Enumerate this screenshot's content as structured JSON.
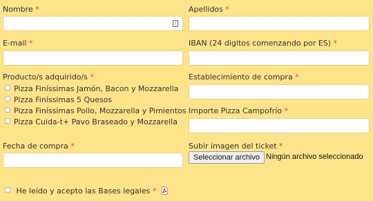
{
  "colors": {
    "background": "#fde38a",
    "required": "#e8452c"
  },
  "fields": {
    "nombre": {
      "label": "Nombre",
      "required_mark": "*",
      "value": ""
    },
    "apellidos": {
      "label": "Apellidos",
      "required_mark": "*",
      "value": ""
    },
    "email": {
      "label": "E-mail",
      "required_mark": "*",
      "value": ""
    },
    "iban": {
      "label": "IBAN (24 digitos comenzando por ES)",
      "required_mark": "*",
      "value": ""
    },
    "producto": {
      "label": "Producto/s adquirido/s",
      "required_mark": "*",
      "options": [
        "Pizza Finíssimas Jamón, Bacon y Mozzarella",
        "Pizza Finíssimas 5 Quesos",
        "Pizza Finíssimas Pollo, Mozzarella y Pimientos",
        "Pizza Cuida-t+ Pavo Braseado y Mozzarella"
      ]
    },
    "establecimiento": {
      "label": "Establecimiento de compra",
      "required_mark": "*",
      "value": ""
    },
    "importe": {
      "label": "Importe Pizza Campofrío",
      "required_mark": "*",
      "value": ""
    },
    "fecha": {
      "label": "Fecha de compra",
      "required_mark": "*",
      "value": ""
    },
    "ticket": {
      "label": "Subir imagen del ticket",
      "required_mark": "*",
      "button_label": "Seleccionar archivo",
      "status": "Ningún archivo seleccionado"
    }
  },
  "legal": {
    "label": "He leído y acepto las Bases legales",
    "required_mark": "*",
    "icon": "pdf-icon"
  }
}
